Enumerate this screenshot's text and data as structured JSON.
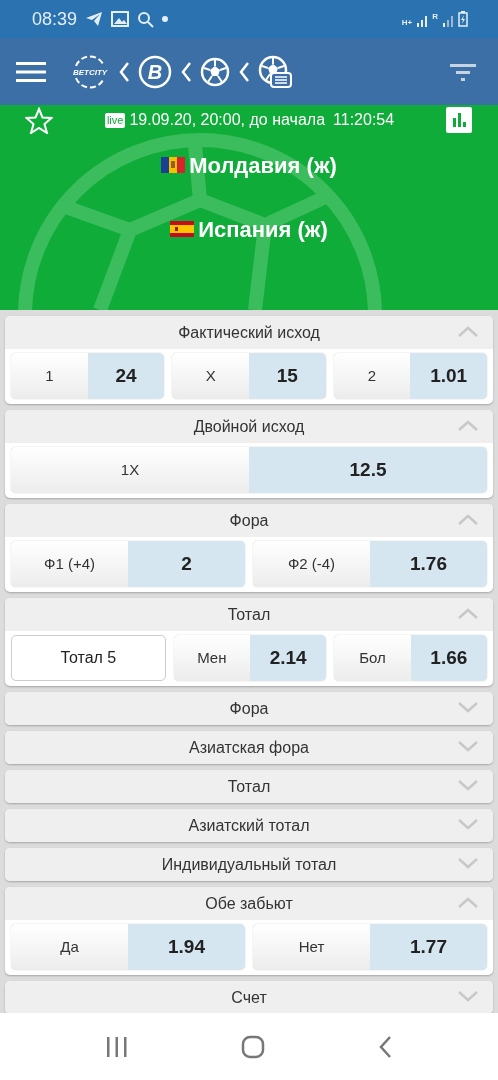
{
  "status_bar": {
    "time": "08:39",
    "network_type": "H+",
    "roaming_mark": "R"
  },
  "app_bar": {
    "logo_text": "BETCITY",
    "sport_logo_letter": "B"
  },
  "match": {
    "favorite": false,
    "live_badge": "live",
    "datetime": "19.09.20, 20:00, до начала",
    "countdown": "11:20:54",
    "teams": [
      {
        "name": "Молдавия (ж)",
        "kind": "moldova"
      },
      {
        "name": "Испания (ж)",
        "kind": "spain"
      }
    ]
  },
  "markets": [
    {
      "title": "Фактический исход",
      "expanded": true,
      "outcomes": [
        {
          "kind": "bet",
          "label": "1",
          "odds": "24"
        },
        {
          "kind": "bet",
          "label": "X",
          "odds": "15"
        },
        {
          "kind": "bet",
          "label": "2",
          "odds": "1.01"
        }
      ]
    },
    {
      "title": "Двойной исход",
      "expanded": true,
      "outcomes": [
        {
          "kind": "bet",
          "label": "1X",
          "odds": "12.5"
        }
      ]
    },
    {
      "title": "Фора",
      "expanded": true,
      "outcomes": [
        {
          "kind": "bet",
          "label": "Ф1 (+4)",
          "odds": "2"
        },
        {
          "kind": "bet",
          "label": "Ф2 (-4)",
          "odds": "1.76"
        }
      ]
    },
    {
      "title": "Тотал",
      "expanded": true,
      "outcomes": [
        {
          "kind": "line",
          "label": "Тотал 5"
        },
        {
          "kind": "bet",
          "label": "Мен",
          "odds": "2.14"
        },
        {
          "kind": "bet",
          "label": "Бол",
          "odds": "1.66"
        }
      ]
    },
    {
      "title": "Фора",
      "expanded": false
    },
    {
      "title": "Азиатская фора",
      "expanded": false
    },
    {
      "title": "Тотал",
      "expanded": false
    },
    {
      "title": "Азиатский тотал",
      "expanded": false
    },
    {
      "title": "Индивидуальный тотал",
      "expanded": false
    },
    {
      "title": "Обе забьют",
      "expanded": true,
      "outcomes": [
        {
          "kind": "bet",
          "label": "Да",
          "odds": "1.94"
        },
        {
          "kind": "bet",
          "label": "Нет",
          "odds": "1.77"
        }
      ]
    },
    {
      "title": "Счет",
      "expanded": false
    }
  ]
}
